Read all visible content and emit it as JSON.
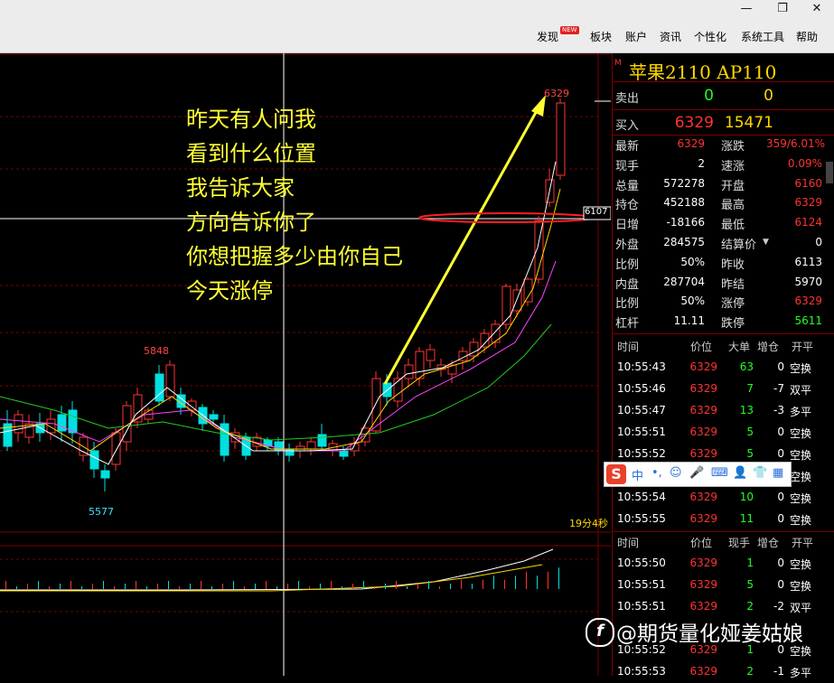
{
  "window": {
    "minimize_glyph": "—",
    "restore_glyph": "❐",
    "close_glyph": "✕"
  },
  "menu": {
    "items": [
      "发现",
      "板块",
      "账户",
      "资讯",
      "个性化",
      "系统工具",
      "帮助"
    ],
    "new_badge": "NEW"
  },
  "chart": {
    "annotation_lines": [
      "昨天有人问我",
      "看到什么位置",
      "我告诉大家",
      "方向告诉你了",
      "你想把握多少由你自己",
      "今天涨停"
    ],
    "high_label": "5848",
    "low_label": "5577",
    "top_label": "6329",
    "price_tag": "6107",
    "countdown": "19分4秒",
    "colors": {
      "up": "#ff3333",
      "down": "#00e0e0",
      "ma5": "#ffffff",
      "ma10": "#ffd700",
      "ma20": "#ff44ff",
      "ma60": "#22cc22",
      "arrow": "#ffff33",
      "ellipse": "#ff2020"
    }
  },
  "quote": {
    "marker": "M",
    "title": "苹果2110  AP110",
    "sell_label": "卖出",
    "sell_price": "0",
    "sell_volume": "0",
    "buy_label": "买入",
    "buy_price": "6329",
    "buy_volume": "15471",
    "rows": [
      {
        "l1": "最新",
        "v1": "6329",
        "c1": "#ff3333",
        "l2": "涨跌",
        "v2": "359/6.01%",
        "c2": "#ff3333"
      },
      {
        "l1": "现手",
        "v1": "2",
        "c1": "#ffffff",
        "l2": "速涨",
        "v2": "0.09%",
        "c2": "#ff3333"
      },
      {
        "l1": "总量",
        "v1": "572278",
        "c1": "#ffffff",
        "l2": "开盘",
        "v2": "6160",
        "c2": "#ff3333"
      },
      {
        "l1": "持仓",
        "v1": "452188",
        "c1": "#ffffff",
        "l2": "最高",
        "v2": "6329",
        "c2": "#ff3333"
      },
      {
        "l1": "日增",
        "v1": "-18166",
        "c1": "#ffffff",
        "l2": "最低",
        "v2": "6124",
        "c2": "#ff3333"
      },
      {
        "l1": "外盘",
        "v1": "284575",
        "c1": "#ffffff",
        "l2": "结算价",
        "v2": "0",
        "c2": "#ffffff"
      },
      {
        "l1": "比例",
        "v1": "50%",
        "c1": "#ffffff",
        "l2": "昨收",
        "v2": "6113",
        "c2": "#ffffff"
      },
      {
        "l1": "内盘",
        "v1": "287704",
        "c1": "#ffffff",
        "l2": "昨结",
        "v2": "5970",
        "c2": "#ffffff"
      },
      {
        "l1": "比例",
        "v1": "50%",
        "c1": "#ffffff",
        "l2": "涨停",
        "v2": "6329",
        "c2": "#ff3333"
      },
      {
        "l1": "杠杆",
        "v1": "11.11",
        "c1": "#ffffff",
        "l2": "跌停",
        "v2": "5611",
        "c2": "#22ff22"
      }
    ]
  },
  "ticks1": {
    "headers": [
      "时间",
      "价位",
      "大单",
      "增仓",
      "开平"
    ],
    "rows": [
      {
        "t": "10:55:43",
        "p": "6329",
        "v": "63",
        "d": "0",
        "k": "空换"
      },
      {
        "t": "10:55:46",
        "p": "6329",
        "v": "7",
        "d": "-7",
        "k": "双平"
      },
      {
        "t": "10:55:47",
        "p": "6329",
        "v": "13",
        "d": "-3",
        "k": "多平"
      },
      {
        "t": "10:55:51",
        "p": "6329",
        "v": "5",
        "d": "0",
        "k": "空换"
      },
      {
        "t": "10:55:52",
        "p": "6329",
        "v": "5",
        "d": "0",
        "k": "空换"
      },
      {
        "t": "",
        "p": "",
        "v": "",
        "d": "",
        "k": "空换"
      },
      {
        "t": "10:55:54",
        "p": "6329",
        "v": "10",
        "d": "0",
        "k": "空换"
      },
      {
        "t": "10:55:55",
        "p": "6329",
        "v": "11",
        "d": "0",
        "k": "空换"
      }
    ]
  },
  "ticks2": {
    "headers": [
      "时间",
      "价位",
      "现手",
      "增仓",
      "开平"
    ],
    "rows": [
      {
        "t": "10:55:50",
        "p": "6329",
        "v": "1",
        "d": "0",
        "k": "空换"
      },
      {
        "t": "10:55:51",
        "p": "6329",
        "v": "5",
        "d": "0",
        "k": "空换"
      },
      {
        "t": "10:55:51",
        "p": "6329",
        "v": "2",
        "d": "-2",
        "k": "双平"
      },
      {
        "t": "",
        "p": "",
        "v": "",
        "d": "",
        "k": ""
      },
      {
        "t": "10:55:52",
        "p": "6329",
        "v": "1",
        "d": "0",
        "k": "空换"
      },
      {
        "t": "10:55:53",
        "p": "6329",
        "v": "2",
        "d": "-1",
        "k": "多平"
      }
    ]
  },
  "ime": {
    "logo": "S",
    "lang": "中"
  },
  "watermark": {
    "logo": "f",
    "text": "@期货量化娅姜姑娘"
  }
}
